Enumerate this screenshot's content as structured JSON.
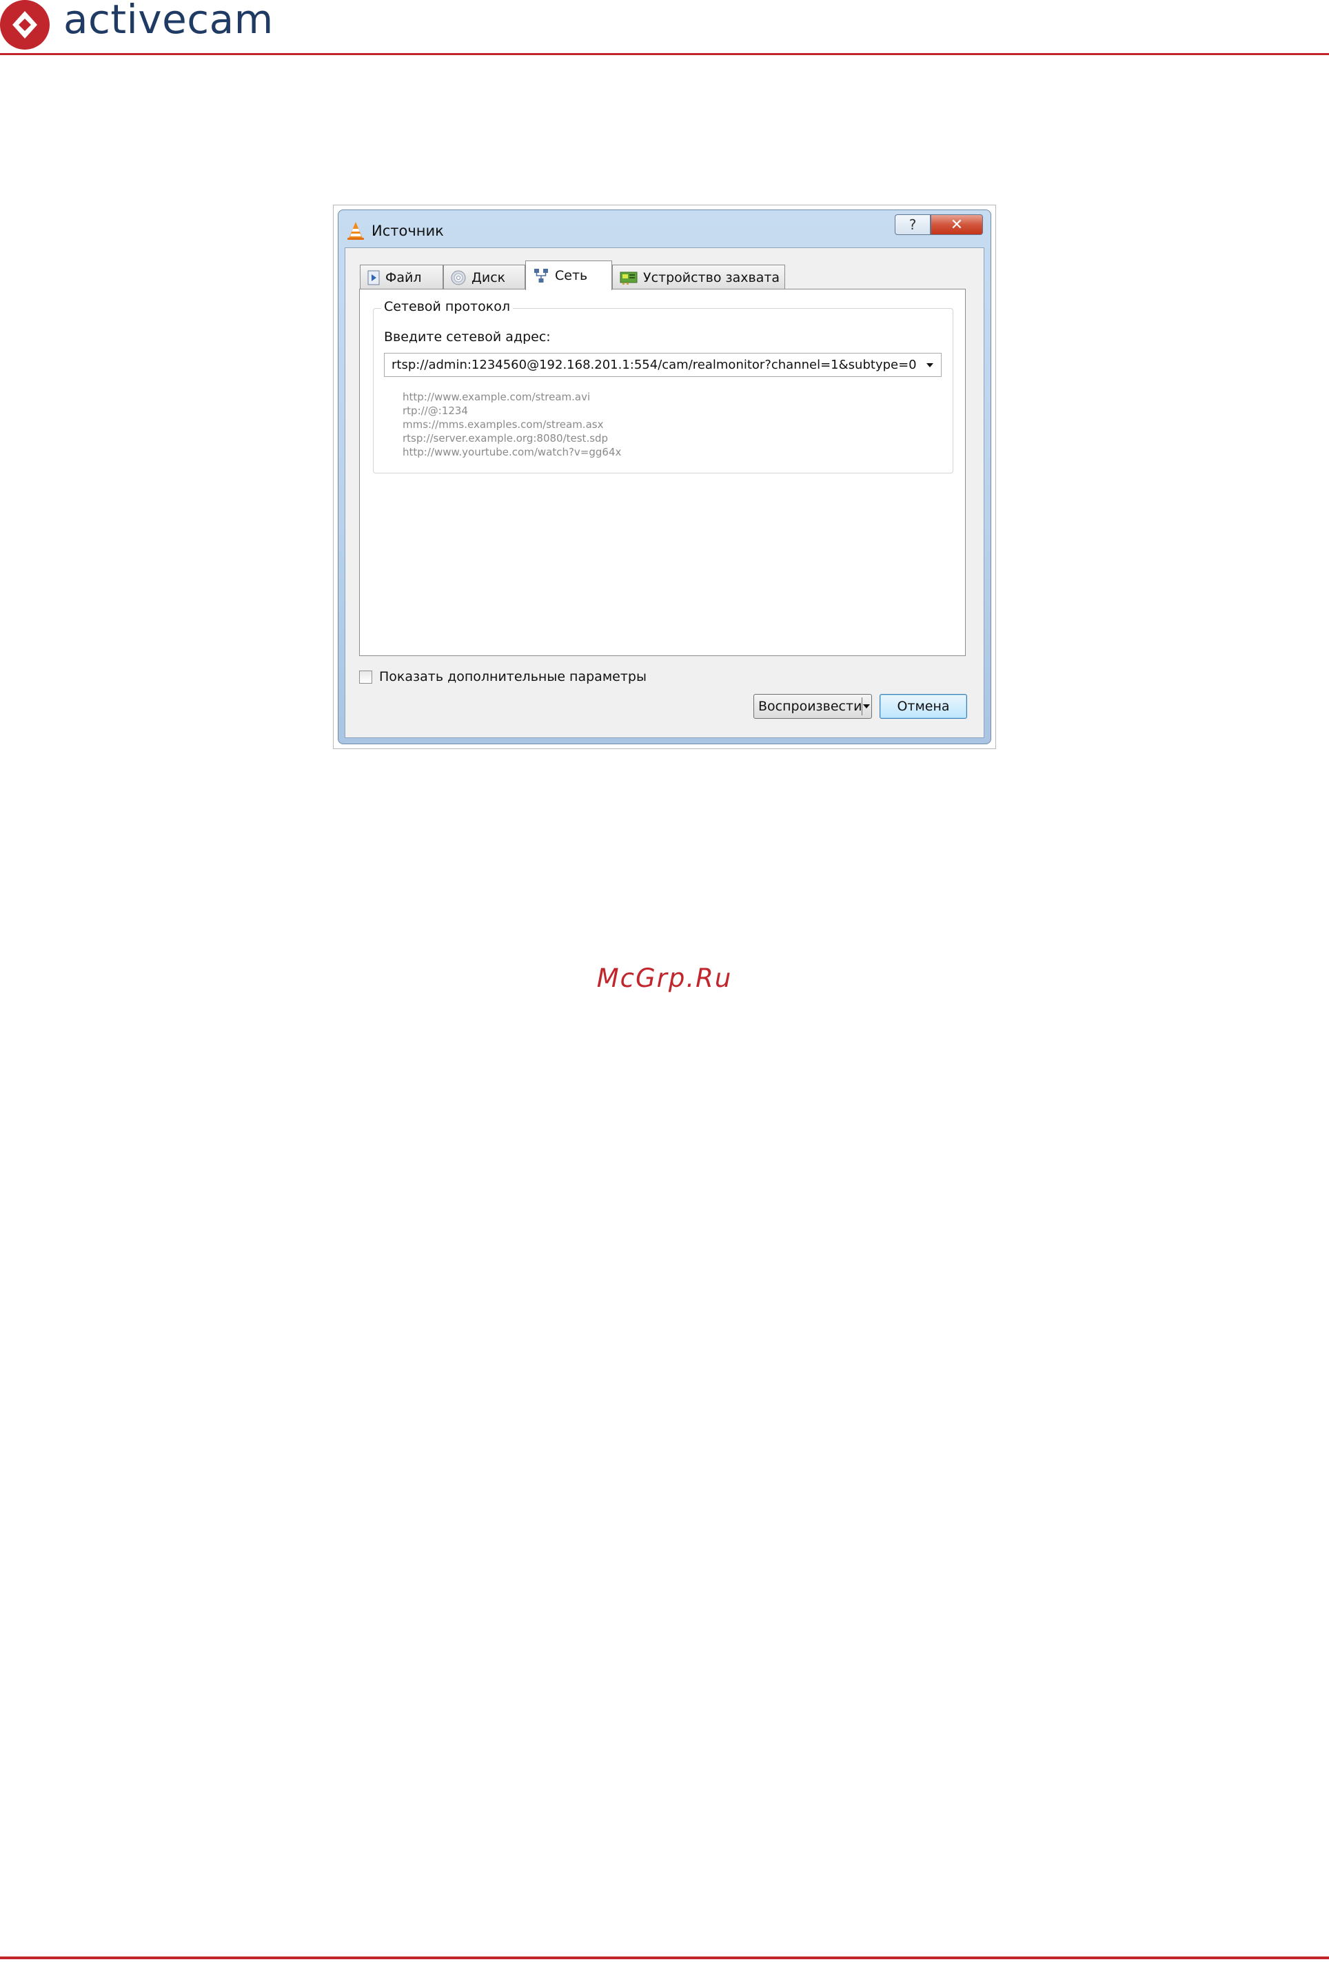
{
  "header": {
    "brand": "activecam",
    "brand_color": "#1f3a63",
    "accent_color": "#c0262b"
  },
  "dialog": {
    "title": "Источник",
    "help_glyph": "?",
    "close_glyph": "✕",
    "tabs": [
      {
        "label": "Файл",
        "icon": "play-file-icon"
      },
      {
        "label": "Диск",
        "icon": "disc-icon"
      },
      {
        "label": "Сеть",
        "icon": "network-icon",
        "active": true
      },
      {
        "label": "Устройство захвата",
        "icon": "capture-card-icon"
      }
    ],
    "group_title": "Сетевой протокол",
    "address_label": "Введите сетевой адрес:",
    "address_value": "rtsp://admin:1234560@192.168.201.1:554/cam/realmonitor?channel=1&subtype=0",
    "examples": [
      "http://www.example.com/stream.avi",
      "rtp://@:1234",
      "mms://mms.examples.com/stream.asx",
      "rtsp://server.example.org:8080/test.sdp",
      "http://www.yourtube.com/watch?v=gg64x"
    ],
    "show_more_label": "Показать дополнительные параметры",
    "play_label": "Воспроизвести",
    "cancel_label": "Отмена"
  },
  "watermark": "McGrp.Ru"
}
